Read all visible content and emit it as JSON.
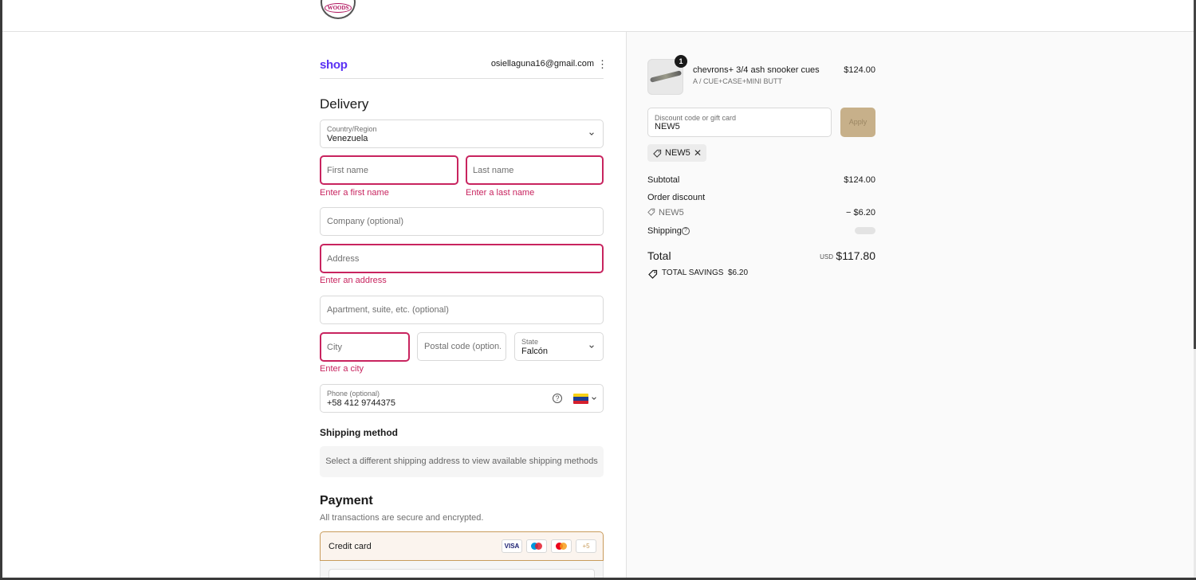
{
  "header": {
    "logo_text": "WOODS"
  },
  "shop_pay": {
    "logo": "shop",
    "email": "osiellaguna16@gmail.com",
    "menu_icon": "kebab-menu-icon"
  },
  "delivery": {
    "title": "Delivery",
    "country": {
      "label": "Country/Region",
      "value": "Venezuela"
    },
    "first_name": {
      "placeholder": "First name",
      "error": "Enter a first name"
    },
    "last_name": {
      "placeholder": "Last name",
      "error": "Enter a last name"
    },
    "company": {
      "placeholder": "Company (optional)"
    },
    "address": {
      "placeholder": "Address",
      "error": "Enter an address"
    },
    "apartment": {
      "placeholder": "Apartment, suite, etc. (optional)"
    },
    "city": {
      "placeholder": "City",
      "error": "Enter a city"
    },
    "postal": {
      "placeholder": "Postal code (option..."
    },
    "state": {
      "label": "State",
      "value": "Falcón"
    },
    "phone": {
      "label": "Phone (optional)",
      "value": "+58 412 9744375",
      "flag": "venezuela-flag-icon"
    }
  },
  "shipping": {
    "title": "Shipping method",
    "message": "Select a different shipping address to view available shipping methods"
  },
  "payment": {
    "title": "Payment",
    "subtitle": "All transactions are secure and encrypted.",
    "method": "Credit card",
    "cards": [
      "VISA",
      "maestro",
      "mastercard"
    ],
    "more": "+5"
  },
  "summary": {
    "product": {
      "qty": "1",
      "name": "chevrons+ 3/4 ash snooker cues",
      "variant": "A / CUE+CASE+MINI BUTT",
      "price": "$124.00"
    },
    "discount": {
      "label": "Discount code or gift card",
      "value": "NEW5",
      "apply": "Apply"
    },
    "applied_code": "NEW5",
    "subtotal_label": "Subtotal",
    "subtotal": "$124.00",
    "order_discount_label": "Order discount",
    "discount_code": "NEW5",
    "discount_amount": "− $6.20",
    "shipping_label": "Shipping",
    "total_label": "Total",
    "currency": "USD",
    "total": "$117.80",
    "savings_label": "TOTAL SAVINGS",
    "savings": "$6.20"
  },
  "colors": {
    "error": "#c8245f",
    "shop_brand": "#5a31f4",
    "apply_button": "#c7b08a",
    "selected_payment_border": "#c89b5b"
  }
}
